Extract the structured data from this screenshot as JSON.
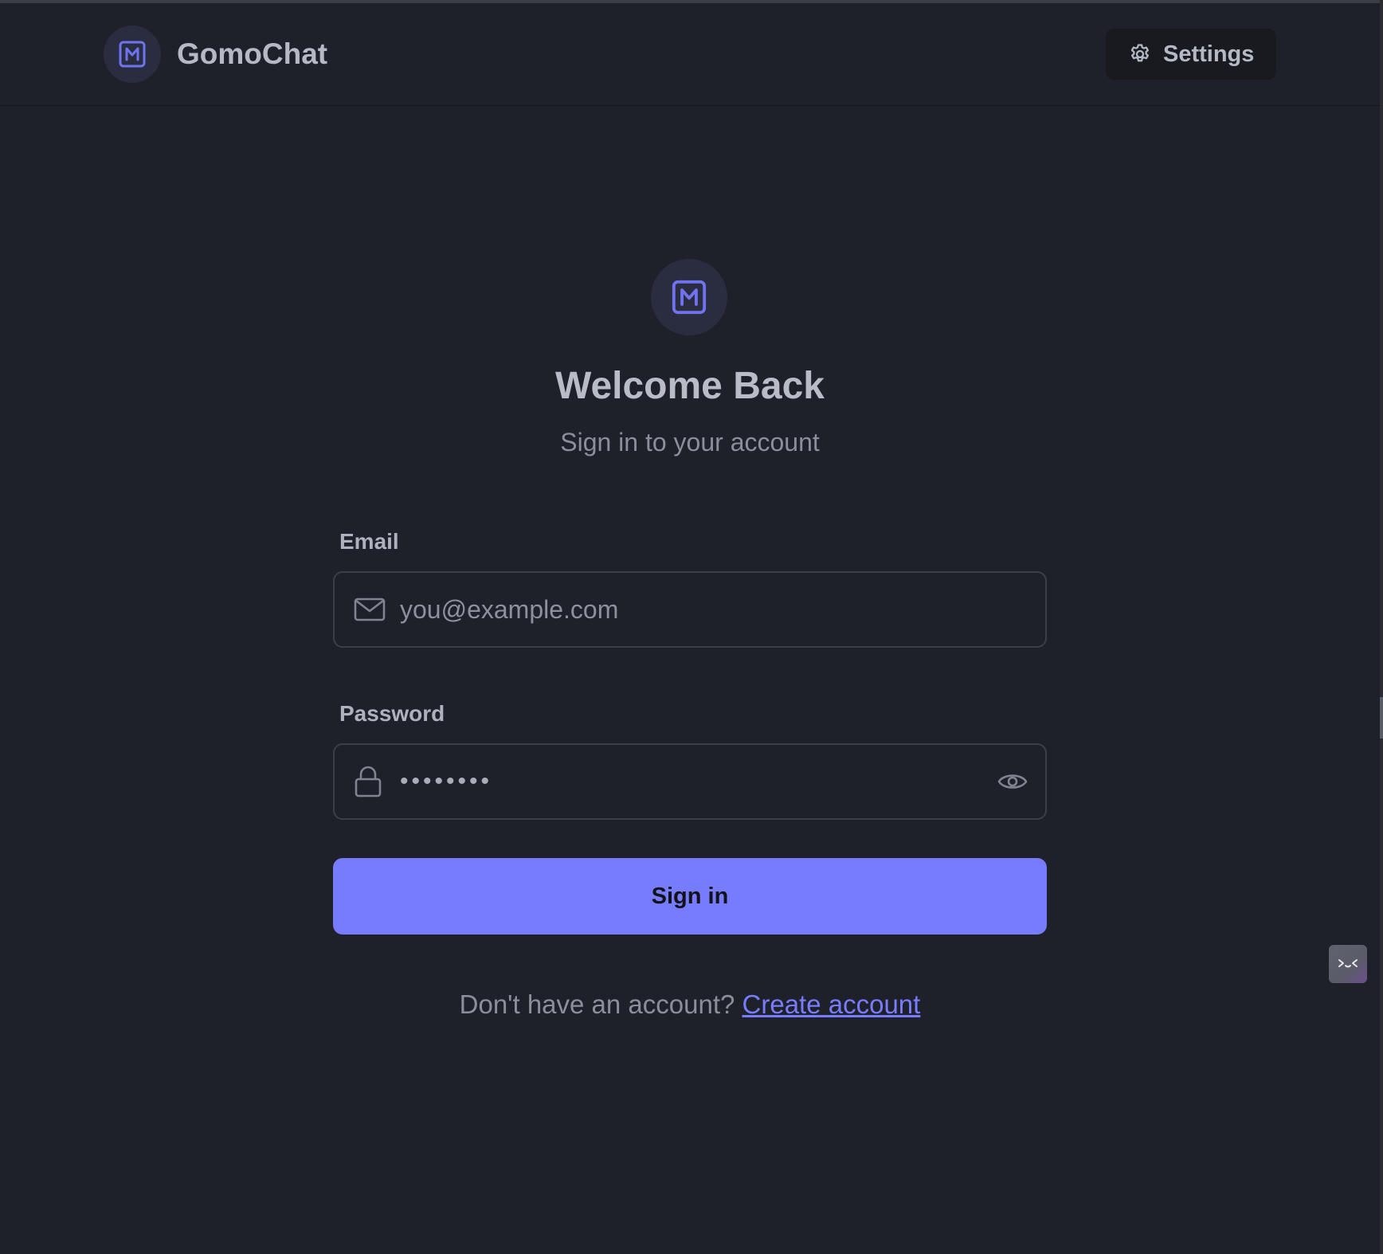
{
  "header": {
    "app_name": "GomoChat",
    "logo_icon": "m-square-icon",
    "settings_label": "Settings",
    "settings_icon": "gear-icon"
  },
  "login": {
    "title": "Welcome Back",
    "subtitle": "Sign in to your account",
    "email": {
      "label": "Email",
      "placeholder": "you@example.com",
      "value": "",
      "icon": "mail-icon"
    },
    "password": {
      "label": "Password",
      "masked_value": "••••••••",
      "icon": "lock-icon",
      "toggle_icon": "eye-icon"
    },
    "submit_label": "Sign in",
    "footer_text": "Don't have an account?",
    "footer_link": "Create account"
  },
  "colors": {
    "background": "#1e2129",
    "accent": "#777bfd",
    "logo_bg": "#2a2d3f",
    "logo_fg": "#6f73f0"
  }
}
